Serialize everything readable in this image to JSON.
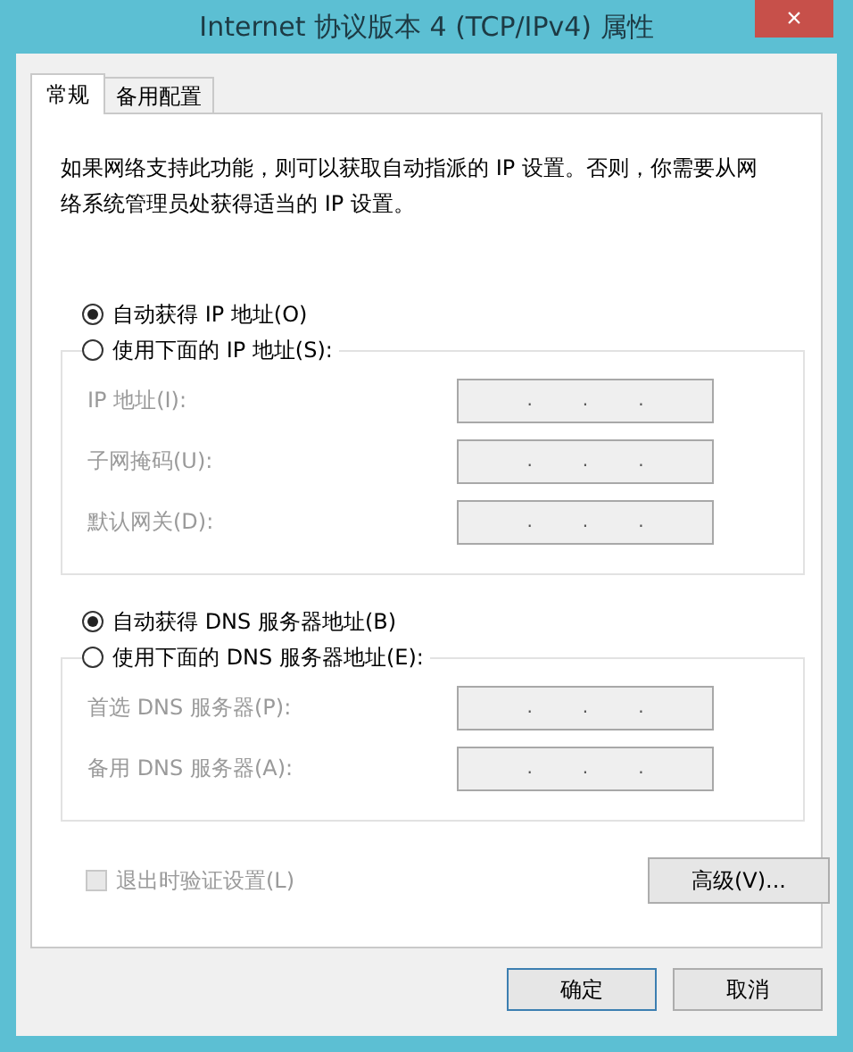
{
  "window": {
    "title": "Internet 协议版本 4 (TCP/IPv4) 属性",
    "close": "×"
  },
  "tabs": [
    {
      "label": "常规",
      "selected": true
    },
    {
      "label": "备用配置",
      "selected": false
    }
  ],
  "description": "如果网络支持此功能，则可以获取自动指派的 IP 设置。否则，你需要从网络系统管理员处获得适当的 IP 设置。",
  "ip_options": [
    {
      "label": "自动获得 IP 地址(O)",
      "selected": true
    },
    {
      "label": "使用下面的 IP 地址(S):",
      "selected": false
    }
  ],
  "ip_fields": [
    {
      "label": "IP 地址(I):",
      "disabled": true,
      "dots": [
        ".",
        ".",
        "."
      ]
    },
    {
      "label": "子网掩码(U):",
      "disabled": true,
      "dots": [
        ".",
        ".",
        "."
      ]
    },
    {
      "label": "默认网关(D):",
      "disabled": true,
      "dots": [
        ".",
        ".",
        "."
      ]
    }
  ],
  "dns_options": [
    {
      "label": "自动获得 DNS 服务器地址(B)",
      "selected": true
    },
    {
      "label": "使用下面的 DNS 服务器地址(E):",
      "selected": false
    }
  ],
  "dns_fields": [
    {
      "label": "首选 DNS 服务器(P):",
      "disabled": true,
      "dots": [
        ".",
        ".",
        "."
      ]
    },
    {
      "label": "备用 DNS 服务器(A):",
      "disabled": true,
      "dots": [
        ".",
        ".",
        "."
      ]
    }
  ],
  "validate": {
    "label": "退出时验证设置(L)",
    "checked": false,
    "disabled": true
  },
  "advanced_button": "高级(V)...",
  "buttons": [
    "确定",
    "取消"
  ]
}
